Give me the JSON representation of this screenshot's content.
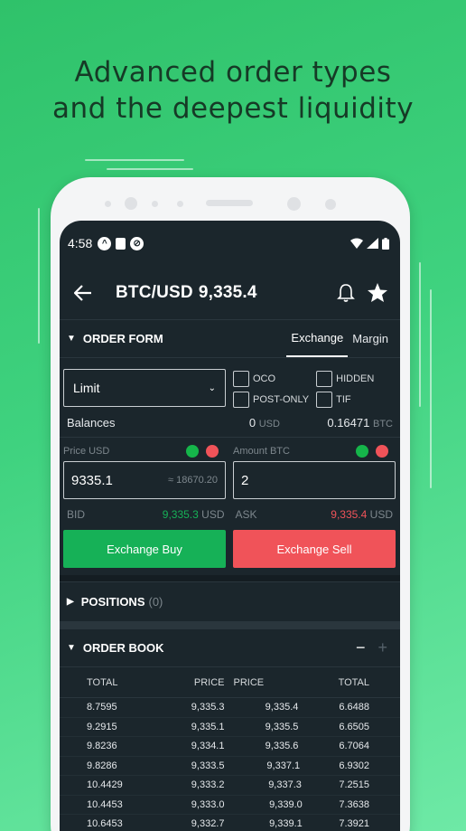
{
  "headline": {
    "line1": "Advanced order types",
    "line2": "and the deepest liquidity"
  },
  "status_bar": {
    "time": "4:58"
  },
  "app_bar": {
    "pair": "BTC/USD",
    "price": "9,335.4"
  },
  "order_form": {
    "title": "ORDER FORM",
    "tabs": [
      {
        "label": "Exchange",
        "active": true
      },
      {
        "label": "Margin",
        "active": false
      }
    ],
    "order_type": "Limit",
    "checkboxes": {
      "oco": "OCO",
      "hidden": "HIDDEN",
      "post_only": "POST-ONLY",
      "tif": "TIF"
    },
    "balances": {
      "label": "Balances",
      "usd_value": "0",
      "usd_unit": "USD",
      "btc_value": "0.16471",
      "btc_unit": "BTC"
    },
    "price_label": "Price USD",
    "amount_label": "Amount BTC",
    "price_value": "9335.1",
    "price_approx": "≈ 18670.20",
    "amount_value": "2",
    "bid": {
      "label": "BID",
      "value": "9,335.3",
      "unit": "USD"
    },
    "ask": {
      "label": "ASK",
      "value": "9,335.4",
      "unit": "USD"
    },
    "buy_label": "Exchange Buy",
    "sell_label": "Exchange Sell"
  },
  "positions": {
    "title": "POSITIONS",
    "count": "(0)"
  },
  "order_book": {
    "title": "ORDER BOOK",
    "minus": "−",
    "plus": "+",
    "headers": {
      "total_bid": "TOTAL",
      "price_bid": "PRICE",
      "price_ask": "PRICE",
      "total_ask": "TOTAL"
    },
    "rows": [
      {
        "bid_total": "8.7595",
        "bid_price": "9,335.3",
        "ask_price": "9,335.4",
        "ask_total": "6.6488",
        "bid_depth": 0.47,
        "ask_depth": 0.4
      },
      {
        "bid_total": "9.2915",
        "bid_price": "9,335.1",
        "ask_price": "9,335.5",
        "ask_total": "6.6505",
        "bid_depth": 0.5,
        "ask_depth": 0.4
      },
      {
        "bid_total": "9.8236",
        "bid_price": "9,334.1",
        "ask_price": "9,335.6",
        "ask_total": "6.7064",
        "bid_depth": 0.53,
        "ask_depth": 0.4
      },
      {
        "bid_total": "9.8286",
        "bid_price": "9,333.5",
        "ask_price": "9,337.1",
        "ask_total": "6.9302",
        "bid_depth": 0.53,
        "ask_depth": 0.42
      },
      {
        "bid_total": "10.4429",
        "bid_price": "9,333.2",
        "ask_price": "9,337.3",
        "ask_total": "7.2515",
        "bid_depth": 0.56,
        "ask_depth": 0.44
      },
      {
        "bid_total": "10.4453",
        "bid_price": "9,333.0",
        "ask_price": "9,339.0",
        "ask_total": "7.3638",
        "bid_depth": 0.56,
        "ask_depth": 0.45
      },
      {
        "bid_total": "10.6453",
        "bid_price": "9,332.7",
        "ask_price": "9,339.1",
        "ask_total": "7.3921",
        "bid_depth": 0.57,
        "ask_depth": 0.45
      }
    ]
  }
}
